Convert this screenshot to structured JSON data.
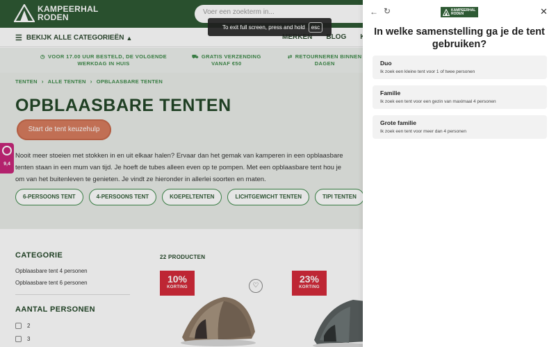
{
  "header": {
    "logo_line1": "KAMPEERHAL",
    "logo_line2": "RODEN",
    "search_placeholder": "Voer een zoekterm in..."
  },
  "catbar": {
    "all_categories": "BEKIJK ALLE CATEGORIEËN",
    "links": [
      "MERKEN",
      "BLOG",
      "KL"
    ]
  },
  "usps": [
    {
      "line1": "VOOR 17.00 UUR BESTELD, DE VOLGENDE",
      "line2": "WERKDAG IN HUIS"
    },
    {
      "line1": "GRATIS VERZENDING",
      "line2": "VANAF €50"
    },
    {
      "line1": "RETOURNEREN BINNEN",
      "line2": "DAGEN"
    }
  ],
  "breadcrumb": [
    "TENTEN",
    "ALLE TENTEN",
    "OPBLAASBARE TENTEN"
  ],
  "page_title": "OPBLAASBARE TENTEN",
  "cta_label": "Start de tent keuzehulp",
  "intro_lines": [
    "Nooit meer stoeien met stokken in en uit elkaar halen? Ervaar dan het gemak van kamperen in een opblaasbare",
    "tenten staan in een mum van tijd. Je hoeft de tubes alleen even op te pompen. Met een opblaasbare tent hou je",
    "om van het buitenleven te genieten. Je vindt ze hieronder in allerlei soorten en maten."
  ],
  "chips": [
    "6-PERSOONS TENT",
    "4-PERSOONS TENT",
    "KOEPELTENTEN",
    "LICHTGEWICHT TENTEN",
    "TIPI TENTEN"
  ],
  "rating_badge": {
    "score": "9,4"
  },
  "filters": {
    "category_title": "CATEGORIE",
    "category_items": [
      "Opblaasbare tent 4 personen",
      "Opblaasbare tent 6 personen"
    ],
    "persons_title": "AANTAL PERSONEN",
    "persons_options": [
      "2",
      "3"
    ]
  },
  "product_count": "22 PRODUCTEN",
  "products": [
    {
      "discount": "10%",
      "discount_label": "KORTING"
    },
    {
      "discount": "23%",
      "discount_label": "KORTING"
    }
  ],
  "drawer": {
    "logo_line1": "KAMPEERHAL",
    "logo_line2": "RODEN",
    "question": "In welke samenstelling ga je de tent gebruiken?",
    "options": [
      {
        "title": "Duo",
        "desc": "Ik zoek een kleine tent voor 1 of twee personen"
      },
      {
        "title": "Familie",
        "desc": "Ik zoek een tent voor een gezin van maximaal 4 personen"
      },
      {
        "title": "Grote familie",
        "desc": "Ik zoek een tent voor meer dan 4 personen"
      }
    ]
  },
  "toast": {
    "text": "To exit full screen, press and hold",
    "key": "esc"
  },
  "colors": {
    "brand_green": "#2e5a34",
    "accent_green": "#3e8a4a",
    "cta": "#d77c5e",
    "discount_red": "#d42b3a",
    "rating_pink": "#c8267a"
  },
  "icons": {
    "back": "arrow-left-icon",
    "refresh": "refresh-icon",
    "close": "close-icon",
    "wishlist": "heart-icon",
    "menu": "hamburger-icon"
  }
}
